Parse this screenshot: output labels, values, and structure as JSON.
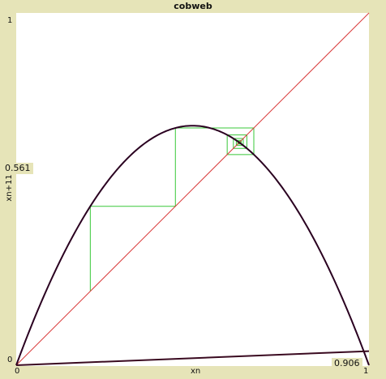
{
  "title": "cobweb",
  "chart_data": {
    "type": "line",
    "title": "cobweb",
    "xlabel": "xn",
    "ylabel": "xn+11",
    "xlim": [
      0,
      1
    ],
    "ylim": [
      0,
      1
    ],
    "x_ticks": [
      "0",
      "1"
    ],
    "y_ticks": [
      "0",
      "1"
    ],
    "readouts": {
      "y_value": "0.561",
      "x_value": "0.906"
    },
    "series": [
      {
        "color": "#2a0020",
        "function": "logistic",
        "r": 2.72,
        "x_range": [
          0,
          1
        ]
      },
      {
        "color": "#d93a3a",
        "function": "identity",
        "x_range": [
          0,
          1
        ]
      },
      {
        "color": "#3a0a20",
        "points": [
          [
            0,
            0
          ],
          [
            1,
            0.04
          ]
        ]
      }
    ],
    "cobweb": {
      "color": "#38c838",
      "x0": 0.21,
      "iterations": 22
    }
  }
}
